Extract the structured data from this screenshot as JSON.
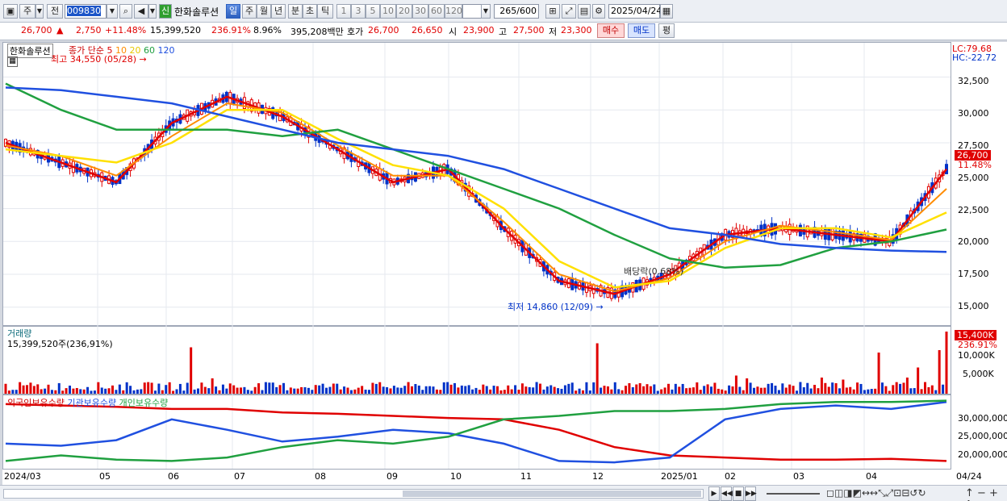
{
  "toolbar": {
    "type_label": "주",
    "prefix_label": "전",
    "code": "009830",
    "stock_name": "한화솔루션",
    "new_badge": "신",
    "periods": [
      "일",
      "주",
      "월",
      "년",
      "분",
      "초",
      "틱"
    ],
    "intervals": [
      "1",
      "3",
      "5",
      "10",
      "20",
      "30",
      "60",
      "120"
    ],
    "count": "265",
    "count_total": "/600",
    "date": "2025/04/24"
  },
  "quote": {
    "price": "26,700",
    "arrow": "▲",
    "change": "2,750",
    "change_pct": "+11.48%",
    "volume": "15,399,520",
    "volume_ratio": "236.91%",
    "turnover": "8.96%",
    "amount": "395,208백만",
    "ask_label": "호가",
    "ask": "26,700",
    "bid": "26,650",
    "open_label": "시",
    "open": "23,900",
    "high_label": "고",
    "high": "27,500",
    "low_label": "저",
    "low": "23,300",
    "buy_label": "매수",
    "sell_label": "매도",
    "eval_label": "평"
  },
  "chart": {
    "legend_name": "한화솔루션",
    "legend_ma_label": "종가 단순",
    "ma_periods": [
      "5",
      "10",
      "20",
      "60",
      "120"
    ],
    "lc": "LC:79.68",
    "hc": "HC:-22.72",
    "high_note": "최고 34,550 (05/28)",
    "low_note": "최저 14,860 (12/09)",
    "dividend_note": "배당락(0.68%)",
    "last_price_tag": "26,700",
    "last_pct": "11.48%",
    "volume_panel_label": "거래량",
    "volume_text": "15,399,520주(236,91%)",
    "volume_tag": "15,400K",
    "volume_pct": "236.91%",
    "holdings_labels": [
      "외국인보유수량",
      "기관보유수량",
      "개인보유수량"
    ],
    "x_labels": [
      "2024/03",
      "05",
      "06",
      "07",
      "08",
      "09",
      "10",
      "11",
      "12",
      "2025/01",
      "02",
      "03",
      "04",
      "04/24"
    ],
    "price_ticks": [
      "32,500",
      "30,000",
      "27,500",
      "25,000",
      "22,500",
      "20,000",
      "17,500",
      "15,000"
    ],
    "volume_ticks": [
      "10,000K",
      "5,000K"
    ],
    "holdings_ticks": [
      "30,000,000",
      "25,000,000",
      "20,000,000"
    ],
    "colors": {
      "ma5": "#e00000",
      "ma10": "#ff8c00",
      "ma20": "#ffe000",
      "ma60": "#20a040",
      "ma120": "#2050e0",
      "up": "#e00000",
      "down": "#0032c8"
    }
  },
  "chart_data": {
    "type": "line",
    "title": "",
    "xlabel": "",
    "ylabel": "",
    "ylim": [
      14000,
      34800
    ],
    "x": [
      "2024/03",
      "05",
      "06",
      "07",
      "08",
      "09",
      "10",
      "11",
      "12",
      "2025/01",
      "02",
      "03",
      "04",
      "04/24"
    ],
    "series": [
      {
        "name": "5",
        "values": [
          27500,
          26000,
          24500,
          29000,
          31000,
          29500,
          27000,
          24500,
          25500,
          21000,
          17000,
          16000,
          17500,
          20500,
          21000,
          20500,
          20000,
          25500
        ]
      },
      {
        "name": "10",
        "values": [
          27300,
          26500,
          25000,
          28000,
          30500,
          29800,
          27300,
          25000,
          25000,
          21500,
          17500,
          16200,
          17200,
          20000,
          21200,
          20700,
          20100,
          24000
        ]
      },
      {
        "name": "20",
        "values": [
          27000,
          26500,
          26000,
          27500,
          30000,
          30000,
          27800,
          25800,
          25000,
          22500,
          18500,
          16500,
          17000,
          19500,
          21000,
          21000,
          20300,
          22200
        ]
      },
      {
        "name": "60",
        "values": [
          32000,
          30000,
          28500,
          28500,
          28500,
          28000,
          28500,
          27000,
          25500,
          24000,
          22500,
          20500,
          18700,
          18000,
          18200,
          19500,
          20000,
          20900
        ]
      },
      {
        "name": "120",
        "values": [
          31700,
          31500,
          31000,
          30500,
          29500,
          28500,
          27500,
          27000,
          26500,
          25500,
          24000,
          22500,
          21000,
          20500,
          19800,
          19500,
          19300,
          19200
        ]
      }
    ],
    "markers": {
      "high": 34550,
      "low": 14860,
      "last": 26700
    }
  }
}
